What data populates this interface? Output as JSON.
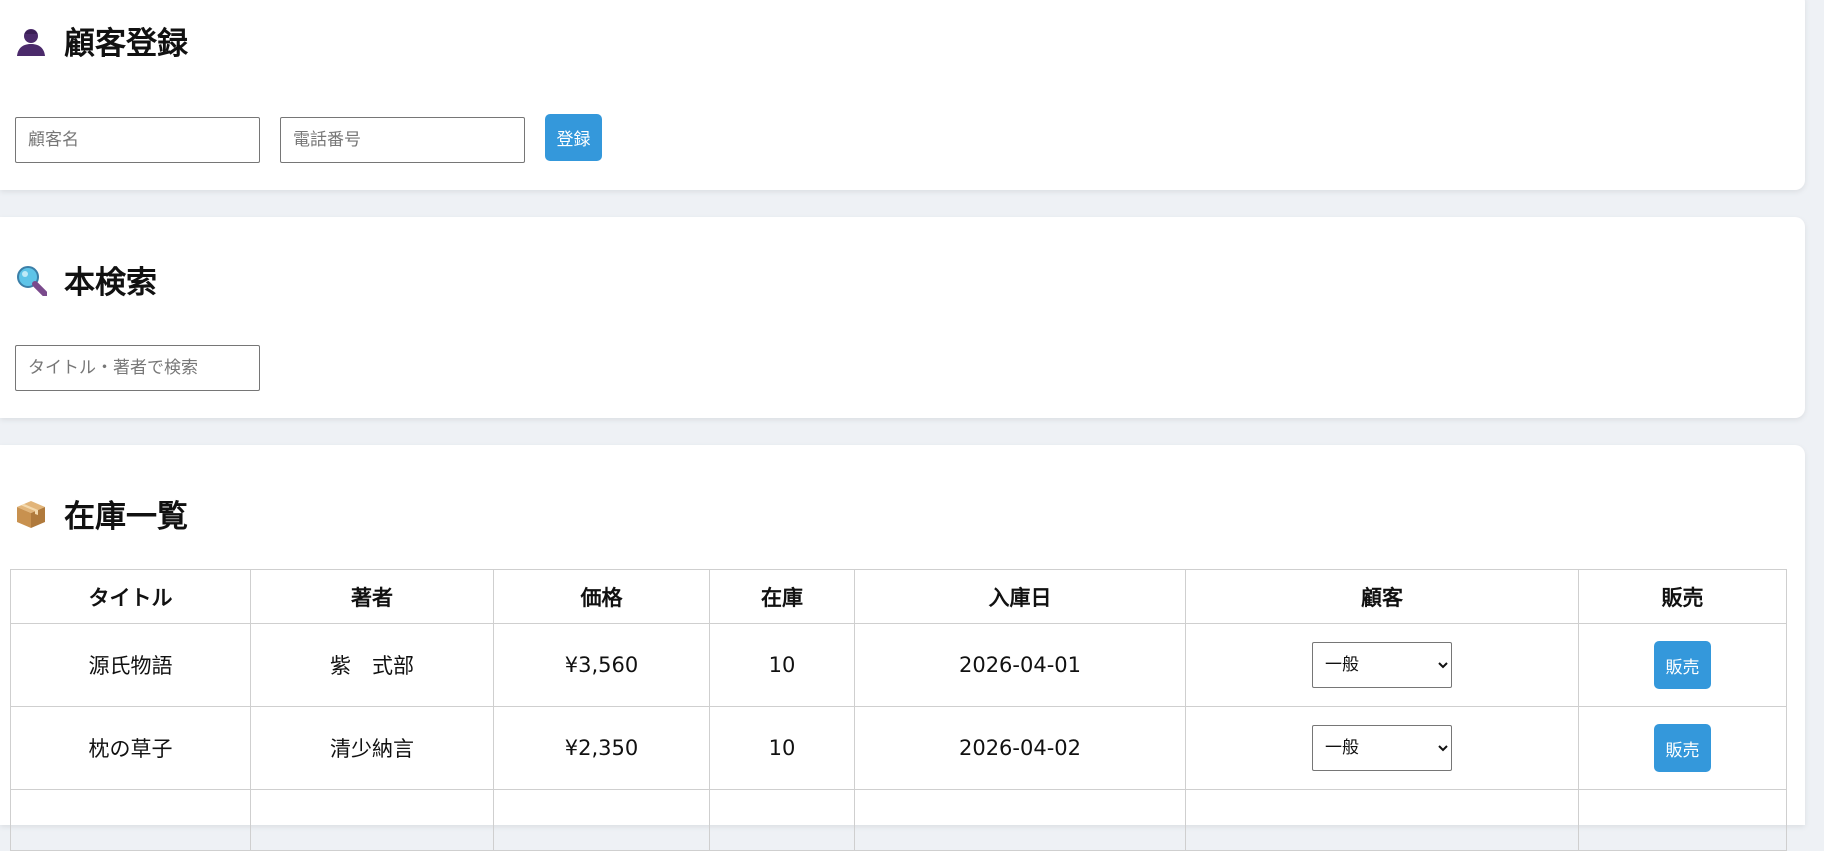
{
  "customer_section": {
    "title": "顧客登録",
    "icon": "person-icon",
    "name_placeholder": "顧客名",
    "phone_placeholder": "電話番号",
    "register_label": "登録"
  },
  "search_section": {
    "title": "本検索",
    "icon": "magnifier-icon",
    "search_placeholder": "タイトル・著者で検索"
  },
  "stock_section": {
    "title": "在庫一覧",
    "icon": "package-icon",
    "columns": [
      "タイトル",
      "著者",
      "価格",
      "在庫",
      "入庫日",
      "顧客",
      "販売"
    ],
    "rows": [
      {
        "title": "源氏物語",
        "author": "紫　式部",
        "price": "¥3,560",
        "stock": "10",
        "date": "2026-04-01",
        "customer": "一般",
        "sell_label": "販売"
      },
      {
        "title": "枕の草子",
        "author": "清少納言",
        "price": "¥2,350",
        "stock": "10",
        "date": "2026-04-02",
        "customer": "一般",
        "sell_label": "販売"
      }
    ]
  },
  "colors": {
    "accent": "#3498db",
    "background": "#eef1f5",
    "card": "#ffffff",
    "border": "#cfcfcf"
  }
}
